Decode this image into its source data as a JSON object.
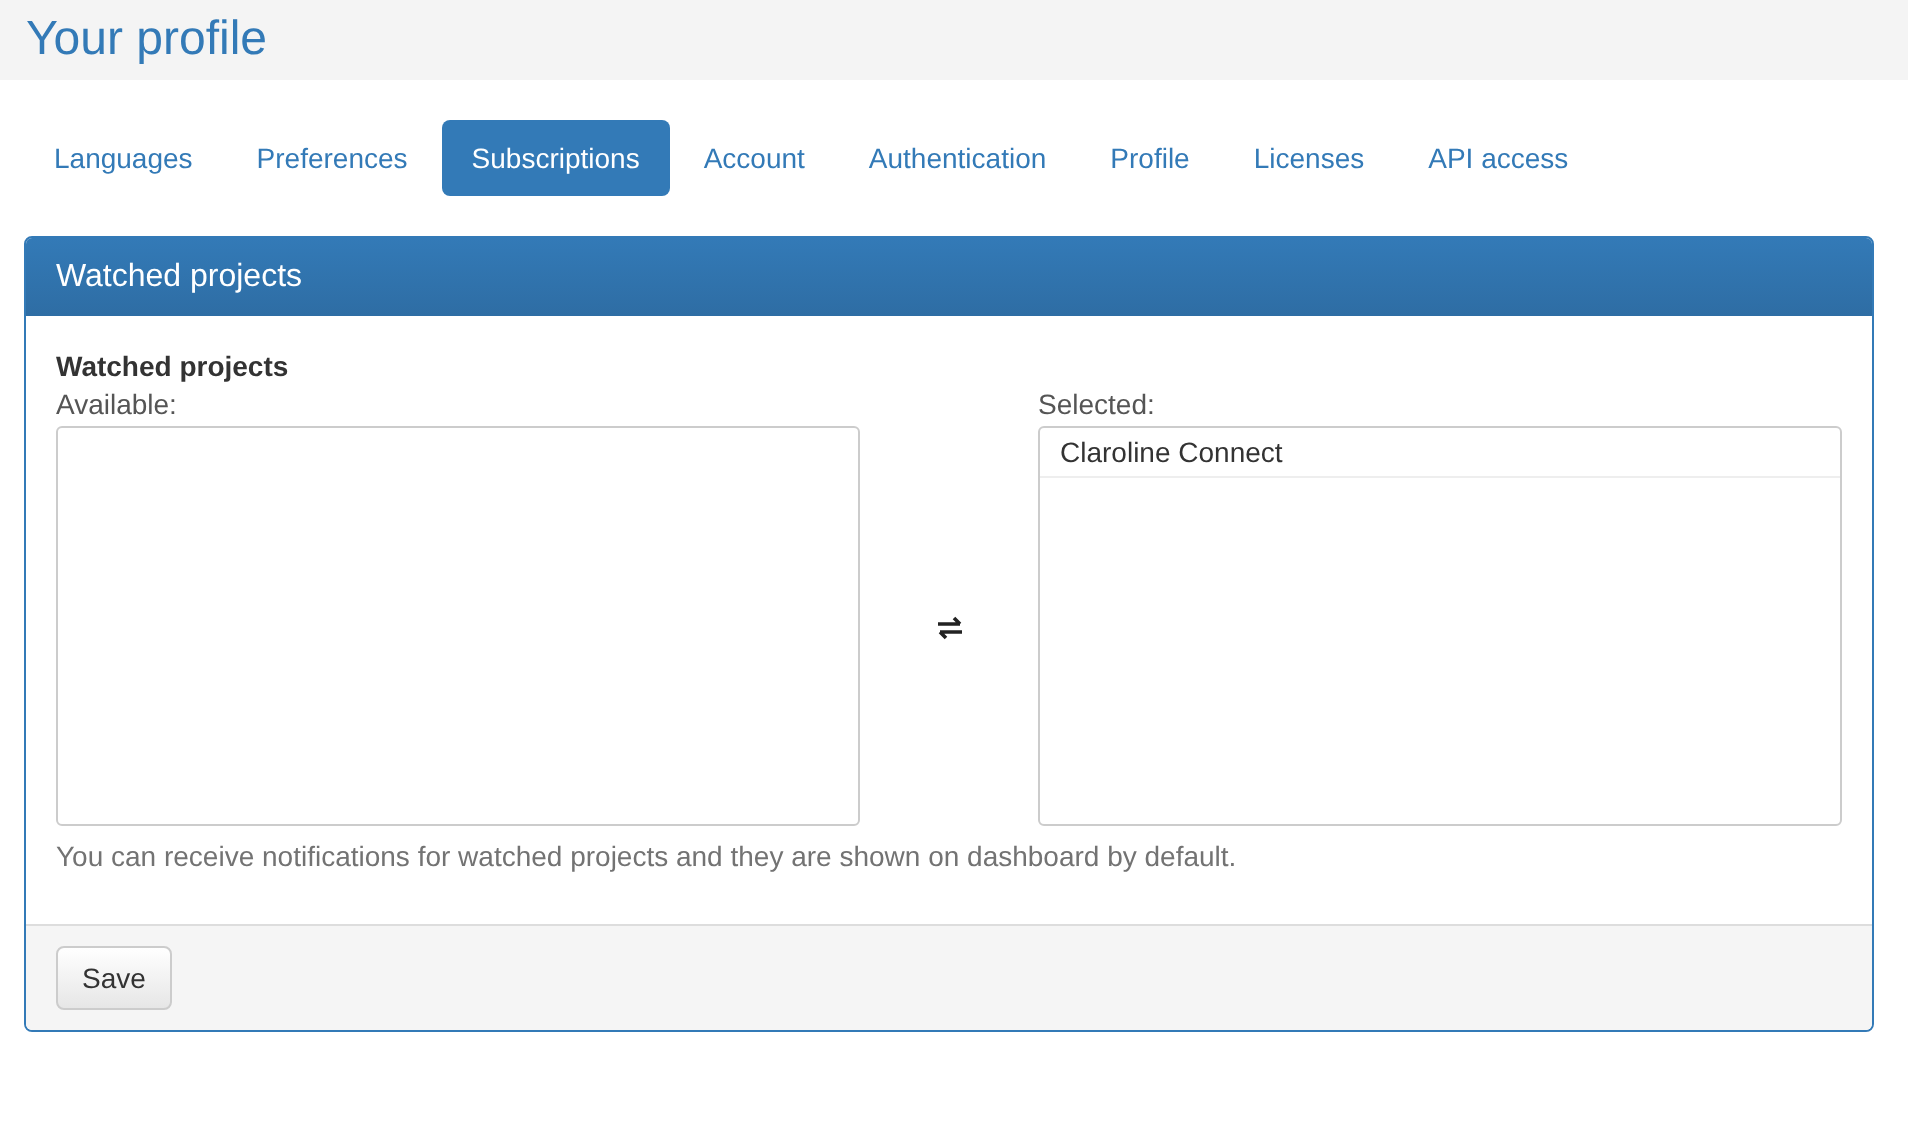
{
  "page_title": "Your profile",
  "tabs": [
    {
      "label": "Languages",
      "selected": false
    },
    {
      "label": "Preferences",
      "selected": false
    },
    {
      "label": "Subscriptions",
      "selected": true
    },
    {
      "label": "Account",
      "selected": false
    },
    {
      "label": "Authentication",
      "selected": false
    },
    {
      "label": "Profile",
      "selected": false
    },
    {
      "label": "Licenses",
      "selected": false
    },
    {
      "label": "API access",
      "selected": false
    }
  ],
  "panel": {
    "title": "Watched projects",
    "section_title": "Watched projects",
    "available": {
      "label": "Available:"
    },
    "selected": {
      "label": "Selected:",
      "items": [
        {
          "label": "Claroline Connect"
        }
      ]
    },
    "help": "You can receive notifications for watched projects and they are shown on dashboard by default.",
    "buttons": [
      "Save"
    ]
  }
}
